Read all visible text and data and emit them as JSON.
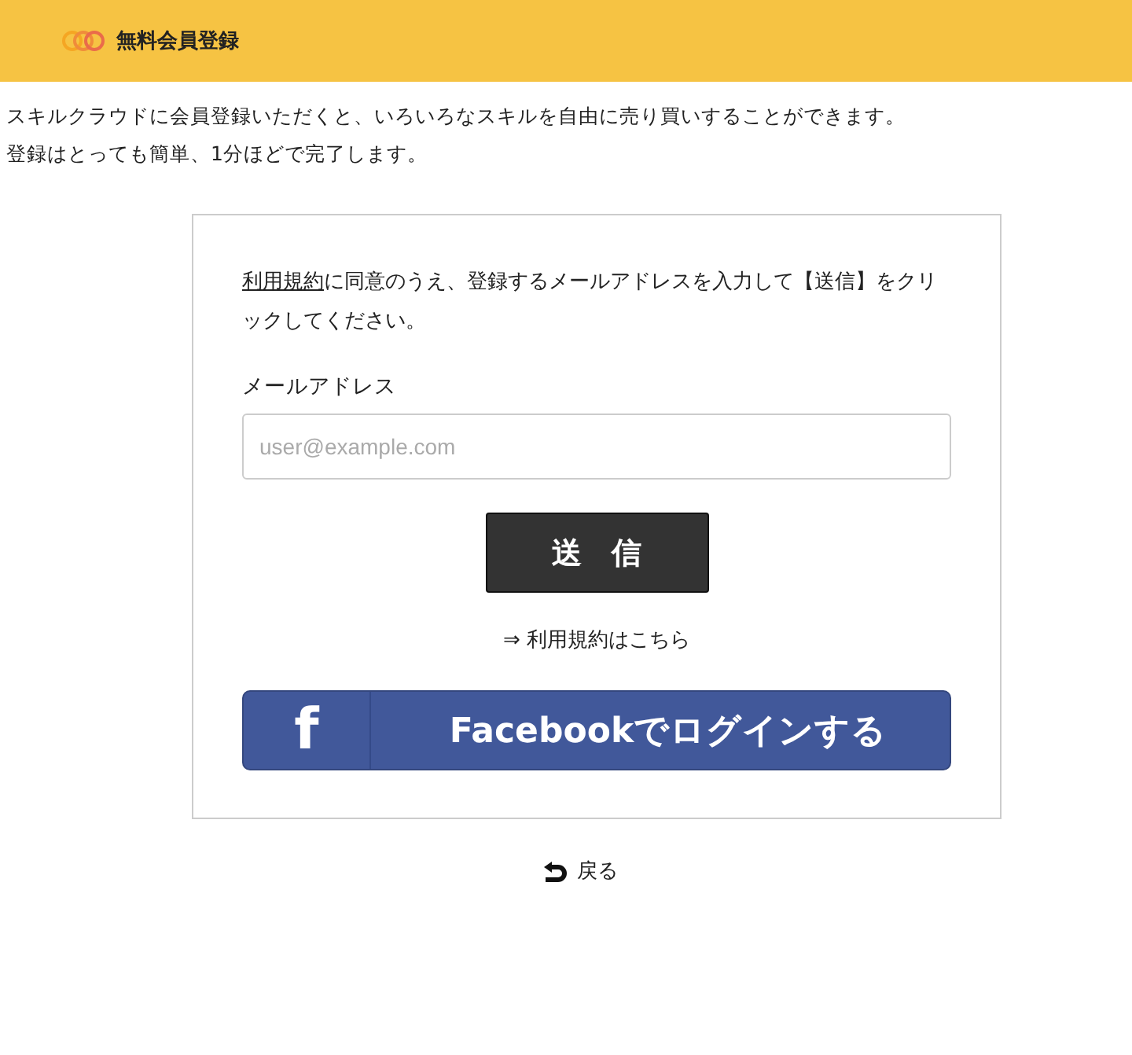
{
  "header": {
    "title": "無料会員登録"
  },
  "intro": [
    "スキルクラウドに会員登録いただくと、いろいろなスキルを自由に売り買いすることができます。",
    "登録はとっても簡単、1分ほどで完了します。"
  ],
  "form": {
    "instruction_link": "利用規約",
    "instruction_rest": "に同意のうえ、登録するメールアドレスを入力して【送信】をクリックしてください。",
    "email_label": "メールアドレス",
    "email_placeholder": "user@example.com",
    "submit": "送　信",
    "terms_link": "⇒ 利用規約はこちら",
    "facebook_logo": "f",
    "facebook_button": "Facebookでログインする"
  },
  "back_link": "戻る"
}
